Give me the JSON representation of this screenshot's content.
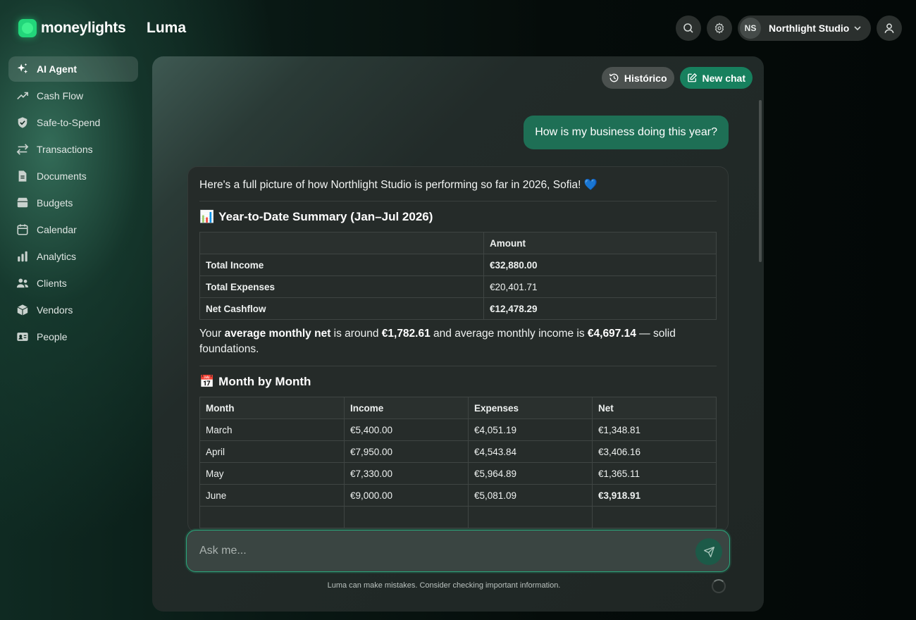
{
  "brand": {
    "name": "moneylights",
    "color": "#22d67a"
  },
  "app_title": "Luma",
  "header": {
    "search_icon": "search-icon",
    "settings_icon": "gear-icon",
    "org": {
      "initials": "NS",
      "name": "Northlight Studio"
    },
    "profile_icon": "user-icon"
  },
  "sidebar": {
    "items": [
      {
        "label": "AI Agent",
        "icon": "sparkles-icon",
        "active": true
      },
      {
        "label": "Cash Flow",
        "icon": "trend-up-icon"
      },
      {
        "label": "Safe-to-Spend",
        "icon": "shield-icon"
      },
      {
        "label": "Transactions",
        "icon": "arrows-icon"
      },
      {
        "label": "Documents",
        "icon": "document-icon"
      },
      {
        "label": "Budgets",
        "icon": "wallet-icon"
      },
      {
        "label": "Calendar",
        "icon": "calendar-icon"
      },
      {
        "label": "Analytics",
        "icon": "bar-chart-icon"
      },
      {
        "label": "Clients",
        "icon": "users-icon"
      },
      {
        "label": "Vendors",
        "icon": "box-icon"
      },
      {
        "label": "People",
        "icon": "id-card-icon"
      }
    ]
  },
  "chat": {
    "history_label": "Histórico",
    "new_chat_label": "New chat",
    "user_message": "How is my business doing this year?",
    "assistant": {
      "greeting": "Here's a full picture of how Northlight Studio is performing so far in 2026, Sofia! 💙",
      "summary_title": "Year-to-Date Summary (Jan–Jul 2026)",
      "summary_emoji": "📊",
      "summary_headers": [
        "",
        "Amount"
      ],
      "summary_rows": [
        {
          "label": "Total Income",
          "amount": "€32,880.00",
          "bold": true
        },
        {
          "label": "Total Expenses",
          "amount": "€20,401.71",
          "bold": false
        },
        {
          "label": "Net Cashflow",
          "amount": "€12,478.29",
          "bold": true
        }
      ],
      "paragraph": {
        "p1": "Your ",
        "b1": "average monthly net",
        "p2": " is around ",
        "b2": "€1,782.61",
        "p3": " and average monthly income is ",
        "b3": "€4,697.14",
        "p4": " — solid foundations."
      },
      "monthly_title": "Month by Month",
      "monthly_emoji": "📅",
      "monthly_headers": [
        "Month",
        "Income",
        "Expenses",
        "Net"
      ],
      "monthly_rows": [
        {
          "month": "March",
          "income": "€5,400.00",
          "expenses": "€4,051.19",
          "net": "€1,348.81",
          "net_bold": false
        },
        {
          "month": "April",
          "income": "€7,950.00",
          "expenses": "€4,543.84",
          "net": "€3,406.16",
          "net_bold": false
        },
        {
          "month": "May",
          "income": "€7,330.00",
          "expenses": "€5,964.89",
          "net": "€1,365.11",
          "net_bold": false
        },
        {
          "month": "June",
          "income": "€9,000.00",
          "expenses": "€5,081.09",
          "net": "€3,918.91",
          "net_bold": true
        }
      ]
    },
    "input_placeholder": "Ask me...",
    "disclaimer": "Luma can make mistakes. Consider checking important information."
  },
  "colors": {
    "accent": "#17805e",
    "user_bubble": "#1e6f55",
    "input_border": "#2aa77c"
  }
}
